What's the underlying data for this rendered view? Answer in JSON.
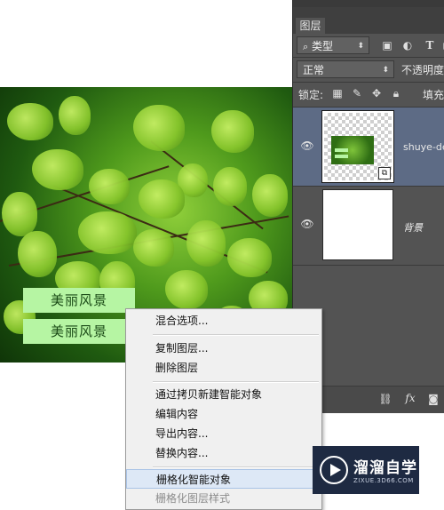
{
  "canvas": {
    "text_layer_1": "美丽风景",
    "text_layer_2": "美丽风景"
  },
  "layers_panel": {
    "tab_label": "图层",
    "filter_dropdown": "类型",
    "blend_mode": "正常",
    "opacity_label": "不透明度",
    "lock_label": "锁定:",
    "fill_label": "填充",
    "icons": [
      "search-icon",
      "image-filter-icon",
      "adjustment-filter-icon",
      "type-filter-icon",
      "shape-filter-icon",
      "lock-transparent-icon",
      "lock-paint-icon",
      "lock-move-icon",
      "lock-all-icon",
      "eye-icon",
      "link-icon",
      "fx-icon",
      "mask-icon"
    ],
    "layers": [
      {
        "name": "shuye-de",
        "type": "smart-object",
        "visible": true,
        "selected": true
      },
      {
        "name": "背景",
        "type": "background",
        "visible": true,
        "selected": false
      }
    ],
    "bottom_fx": "fx"
  },
  "context_menu": {
    "items": [
      {
        "label": "混合选项...",
        "enabled": true
      },
      {
        "label": "复制图层...",
        "enabled": true
      },
      {
        "label": "删除图层",
        "enabled": true
      },
      {
        "label": "通过拷贝新建智能对象",
        "enabled": true
      },
      {
        "label": "编辑内容",
        "enabled": true
      },
      {
        "label": "导出内容...",
        "enabled": true
      },
      {
        "label": "替换内容...",
        "enabled": true
      },
      {
        "label": "栅格化智能对象",
        "enabled": true,
        "highlighted": true
      },
      {
        "label": "栅格化图层样式",
        "enabled": false
      }
    ]
  },
  "watermark": {
    "title": "溜溜自学",
    "subtitle": "ZIXUE.3D66.COM"
  },
  "colors": {
    "panel_bg": "#535353",
    "menu_bg": "#f0f0f0",
    "menu_highlight": "#dde8f6",
    "text_layer_bg": "#b6f5a3"
  }
}
